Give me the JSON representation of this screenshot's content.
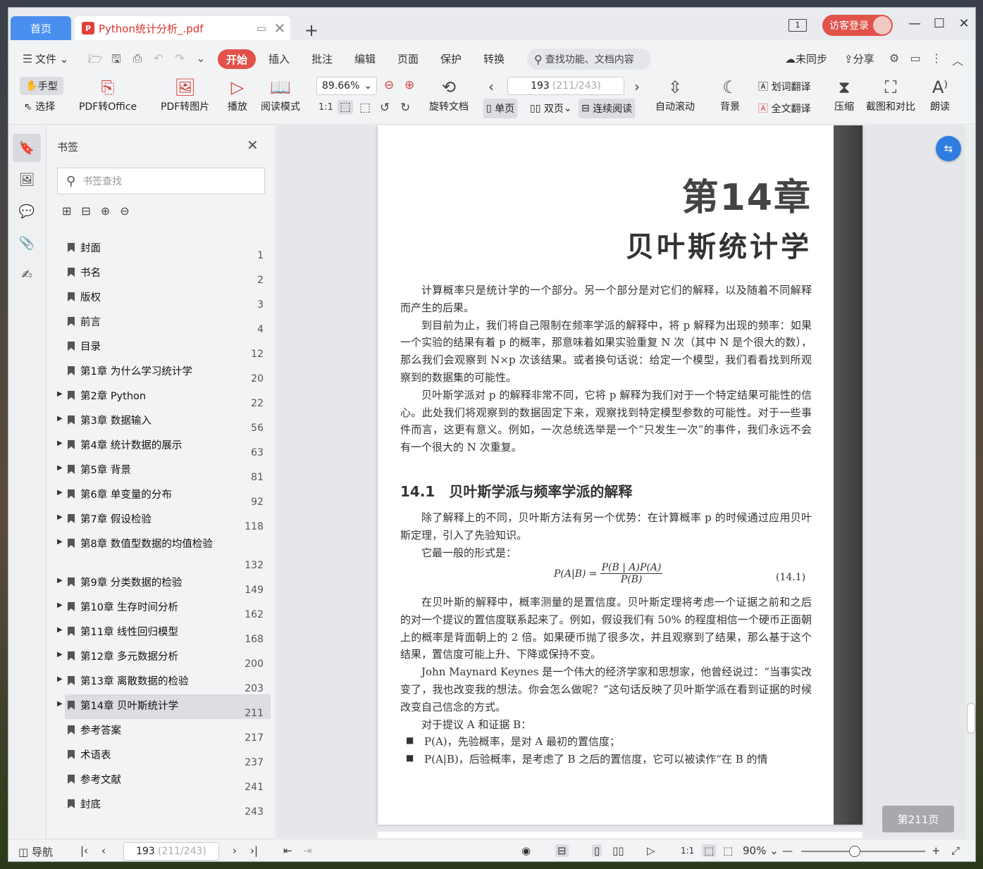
{
  "tabs": {
    "home": "首页",
    "doc_title": "Python统计分析_.pdf",
    "page_indicator": "1"
  },
  "login": {
    "label": "访客登录"
  },
  "menu": {
    "file": "文件",
    "items": [
      "开始",
      "插入",
      "批注",
      "编辑",
      "页面",
      "保护",
      "转换"
    ],
    "search_placeholder": "查找功能、文档内容",
    "sync": "未同步",
    "share": "分享"
  },
  "ribbon": {
    "hand": "手型",
    "select": "选择",
    "pdf_to_office": "PDF转Office",
    "pdf_to_image": "PDF转图片",
    "play": "播放",
    "read_mode": "阅读模式",
    "zoom": "89.66%",
    "rotate": "旋转文档",
    "page_current": "193",
    "page_detail": "(211/243)",
    "single": "单页",
    "double": "双页",
    "continuous": "连续阅读",
    "autoscroll": "自动滚动",
    "background": "背景",
    "word_translate": "划词翻译",
    "full_translate": "全文翻译",
    "compress": "压缩",
    "screenshot": "截图和对比",
    "read_aloud": "朗读"
  },
  "bookmarks": {
    "title": "书签",
    "search_placeholder": "书签查找",
    "items": [
      {
        "label": "封面",
        "page": "1",
        "expandable": false
      },
      {
        "label": "书名",
        "page": "2",
        "expandable": false
      },
      {
        "label": "版权",
        "page": "3",
        "expandable": false
      },
      {
        "label": "前言",
        "page": "4",
        "expandable": false
      },
      {
        "label": "目录",
        "page": "12",
        "expandable": false
      },
      {
        "label": "第1章 为什么学习统计学",
        "page": "20",
        "expandable": false
      },
      {
        "label": "第2章 Python",
        "page": "22",
        "expandable": true
      },
      {
        "label": "第3章 数据输入",
        "page": "56",
        "expandable": true
      },
      {
        "label": "第4章 统计数据的展示",
        "page": "63",
        "expandable": true
      },
      {
        "label": "第5章 背景",
        "page": "81",
        "expandable": true
      },
      {
        "label": "第6章 单变量的分布",
        "page": "92",
        "expandable": true
      },
      {
        "label": "第7章 假设检验",
        "page": "118",
        "expandable": true
      },
      {
        "label": "第8章 数值型数据的均值检验",
        "page": "132",
        "expandable": true,
        "tall": true
      },
      {
        "label": "第9章 分类数据的检验",
        "page": "149",
        "expandable": true
      },
      {
        "label": "第10章 生存时间分析",
        "page": "162",
        "expandable": true
      },
      {
        "label": "第11章 线性回归模型",
        "page": "168",
        "expandable": true
      },
      {
        "label": "第12章 多元数据分析",
        "page": "200",
        "expandable": true
      },
      {
        "label": "第13章 离散数据的检验",
        "page": "203",
        "expandable": true
      },
      {
        "label": "第14章 贝叶斯统计学",
        "page": "211",
        "expandable": true,
        "selected": true
      },
      {
        "label": "参考答案",
        "page": "217",
        "expandable": false
      },
      {
        "label": "术语表",
        "page": "237",
        "expandable": false
      },
      {
        "label": "参考文献",
        "page": "241",
        "expandable": false
      },
      {
        "label": "封底",
        "page": "243",
        "expandable": false
      }
    ]
  },
  "page": {
    "chapter": "第14章",
    "chapter_title": "贝叶斯统计学",
    "p1": "计算概率只是统计学的一个部分。另一个部分是对它们的解释，以及随着不同解释而产生的后果。",
    "p2": "到目前为止，我们将自己限制在频率学派的解释中，将 p 解释为出现的频率：如果一个实验的结果有着 p 的概率，那意味着如果实验重复 N 次（其中 N 是个很大的数），那么我们会观察到 N×p 次该结果。或者换句话说：给定一个模型，我们看看找到所观察到的数据集的可能性。",
    "p3": "贝叶斯学派对 p 的解释非常不同，它将 p 解释为我们对于一个特定结果可能性的信心。此处我们将观察到的数据固定下来，观察找到特定模型参数的可能性。对于一些事件而言，这更有意义。例如，一次总统选举是一个“只发生一次”的事件，我们永远不会有一个很大的 N 次重复。",
    "section": "14.1　贝叶斯学派与频率学派的解释",
    "p4": "除了解释上的不同，贝叶斯方法有另一个优势：在计算概率 p 的时候通过应用贝叶斯定理，引入了先验知识。",
    "p5": "它最一般的形式是：",
    "formula_lhs": "P(A|B) =",
    "formula_num": "P(B | A)P(A)",
    "formula_den": "P(B)",
    "eq_number": "(14.1)",
    "p6": "在贝叶斯的解释中，概率测量的是置信度。贝叶斯定理将考虑一个证据之前和之后的对一个提议的置信度联系起来了。例如，假设我们有 50% 的程度相信一个硬币正面朝上的概率是背面朝上的 2 倍。如果硬币抛了很多次，并且观察到了结果，那么基于这个结果，置信度可能上升、下降或保持不变。",
    "p7": "John Maynard Keynes 是一个伟大的经济学家和思想家，他曾经说过：“当事实改变了，我也改变我的想法。你会怎么做呢？”这句话反映了贝叶斯学派在看到证据的时候改变自己信念的方式。",
    "p8": "对于提议 A 和证据 B：",
    "b1": "P(A)，先验概率，是对 A 最初的置信度；",
    "b2": "P(A|B)，后验概率，是考虑了 B 之后的置信度，它可以被读作“在 B 的情"
  },
  "page_badge": "第211页",
  "status": {
    "nav": "导航",
    "page_current": "193",
    "page_detail": "(211/243)",
    "zoom": "90%"
  }
}
